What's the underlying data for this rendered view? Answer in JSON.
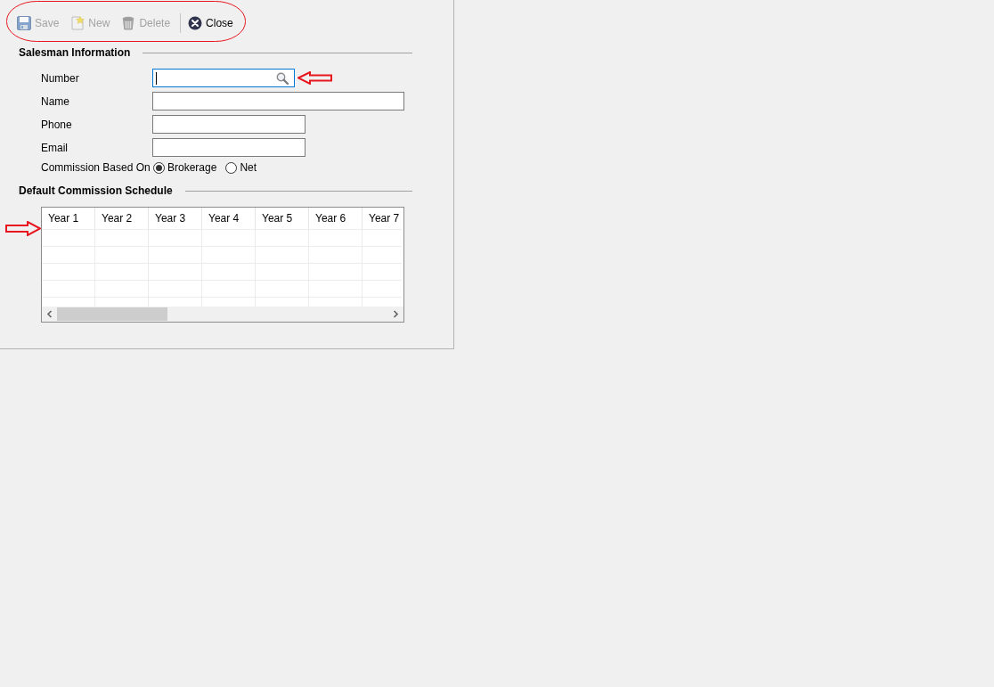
{
  "toolbar": {
    "groups": [
      {
        "buttons": [
          {
            "kind": "save",
            "label": "Save",
            "disabled": true
          },
          {
            "kind": "new",
            "label": "New",
            "disabled": true
          },
          {
            "kind": "delete",
            "label": "Delete",
            "disabled": true
          }
        ]
      },
      {
        "buttons": [
          {
            "kind": "close",
            "label": "Close",
            "disabled": false
          }
        ]
      }
    ]
  },
  "salesman_information": {
    "title": "Salesman Information",
    "fields": [
      {
        "kind": "lookup",
        "label": "Number",
        "focused": true
      },
      {
        "kind": "text",
        "label": "Name",
        "focused": false
      },
      {
        "kind": "text",
        "label": "Phone",
        "focused": false
      },
      {
        "kind": "text",
        "label": "Email",
        "focused": false
      }
    ],
    "commission_based_on": {
      "label": "Commission Based On",
      "options": [
        {
          "label": "Brokerage",
          "selected": true
        },
        {
          "label": "Net",
          "selected": false
        }
      ]
    }
  },
  "default_commission_schedule": {
    "title": "Default Commission Schedule",
    "table": {
      "columns": [
        "Year 1",
        "Year 2",
        "Year 3",
        "Year 4",
        "Year 5",
        "Year 6",
        "Year 7"
      ]
    }
  }
}
